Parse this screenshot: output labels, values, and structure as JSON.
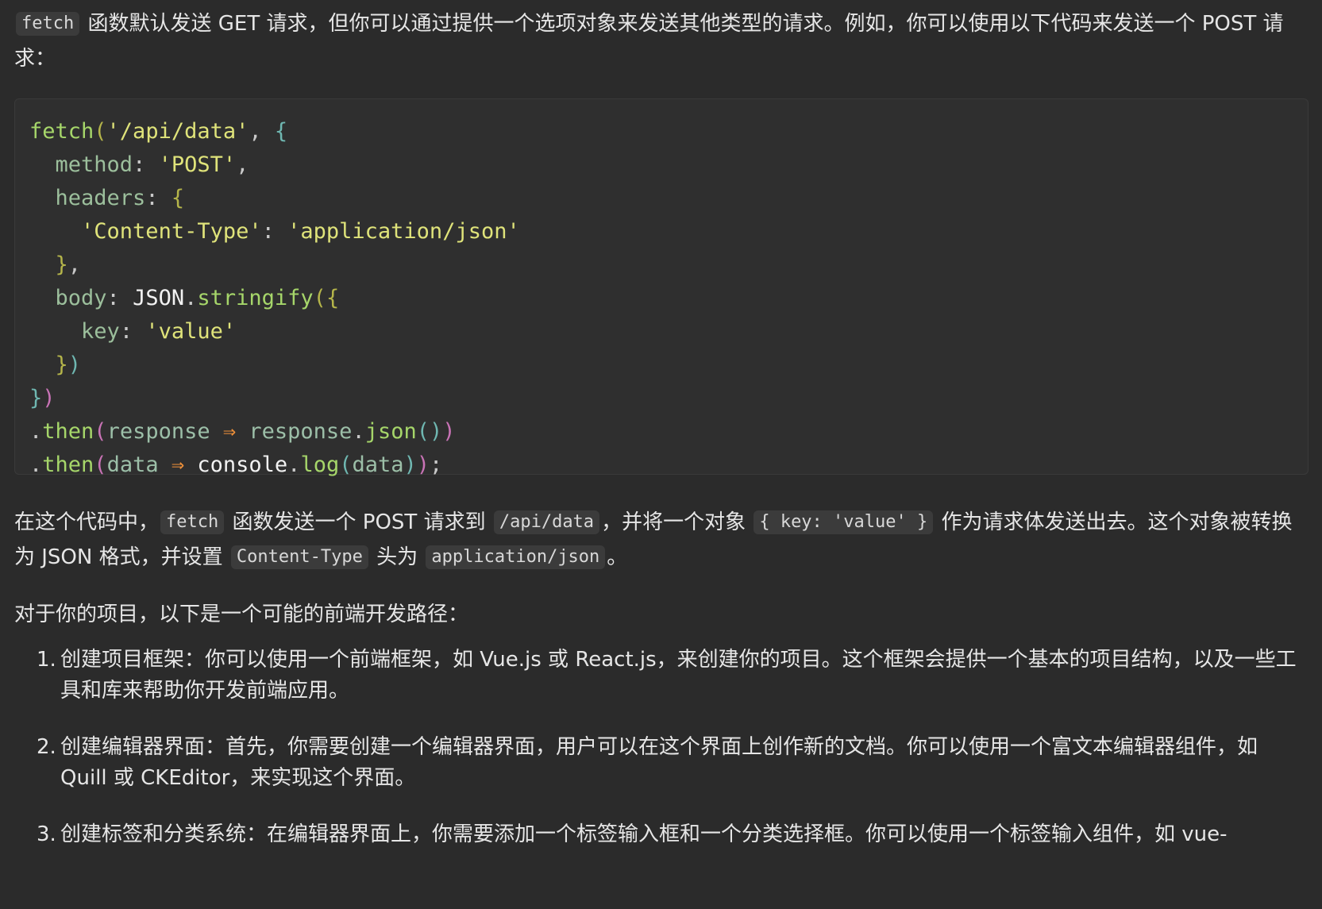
{
  "intro": {
    "code1": "fetch",
    "text1": " 函数默认发送 GET 请求，但你可以通过提供一个选项对象来发送其他类型的请求。例如，你可以使用以下代码来发送一个 POST 请求："
  },
  "code_block": {
    "l1": {
      "fn": "fetch",
      "p1": "(",
      "str": "'/api/data'",
      "comma": ", ",
      "br": "{"
    },
    "l2": {
      "indent": "  ",
      "prop": "method",
      "colon": ": ",
      "str": "'POST'",
      "comma": ","
    },
    "l3": {
      "indent": "  ",
      "prop": "headers",
      "colon": ": ",
      "br": "{"
    },
    "l4": {
      "indent": "    ",
      "str1": "'Content-Type'",
      "colon": ": ",
      "str2": "'application/json'"
    },
    "l5": {
      "indent": "  ",
      "br": "}",
      "comma": ","
    },
    "l6": {
      "indent": "  ",
      "prop": "body",
      "colon": ": ",
      "id": "JSON",
      "dot": ".",
      "fn": "stringify",
      "p1": "(",
      "br": "{"
    },
    "l7": {
      "indent": "    ",
      "prop": "key",
      "colon": ": ",
      "str": "'value'"
    },
    "l8": {
      "indent": "  ",
      "br": "}",
      "p1": ")"
    },
    "l9": {
      "br": "}",
      "p1": ")"
    },
    "l10": {
      "dot": ".",
      "fn": "then",
      "p1": "(",
      "var": "response",
      "arrow": " ⇒ ",
      "var2": "response",
      "dot2": ".",
      "fn2": "json",
      "p2": "()",
      "p3": ")"
    },
    "l11": {
      "dot": ".",
      "fn": "then",
      "p1": "(",
      "var": "data",
      "arrow": " ⇒ ",
      "id": "console",
      "dot2": ".",
      "fn2": "log",
      "p2": "(",
      "var2": "data",
      "p3": ")",
      "p4": ")",
      "semi": ";"
    }
  },
  "explain": {
    "t1": "在这个代码中，",
    "c1": "fetch",
    "t2": " 函数发送一个 POST 请求到 ",
    "c2": "/api/data",
    "t3": "，并将一个对象 ",
    "c3": "{ key: 'value' }",
    "t4": " 作为请求体发送出去。这个对象被转换为 JSON 格式，并设置 ",
    "c4": "Content-Type",
    "t5": " 头为 ",
    "c5": "application/json",
    "t6": "。"
  },
  "path_intro": "对于你的项目，以下是一个可能的前端开发路径：",
  "steps": [
    {
      "num": "1.",
      "text": "创建项目框架：你可以使用一个前端框架，如 Vue.js 或 React.js，来创建你的项目。这个框架会提供一个基本的项目结构，以及一些工具和库来帮助你开发前端应用。"
    },
    {
      "num": "2.",
      "text": "创建编辑器界面：首先，你需要创建一个编辑器界面，用户可以在这个界面上创作新的文档。你可以使用一个富文本编辑器组件，如 Quill 或 CKEditor，来实现这个界面。"
    },
    {
      "num": "3.",
      "text": "创建标签和分类系统：在编辑器界面上，你需要添加一个标签输入框和一个分类选择框。你可以使用一个标签输入组件，如 vue-"
    }
  ]
}
